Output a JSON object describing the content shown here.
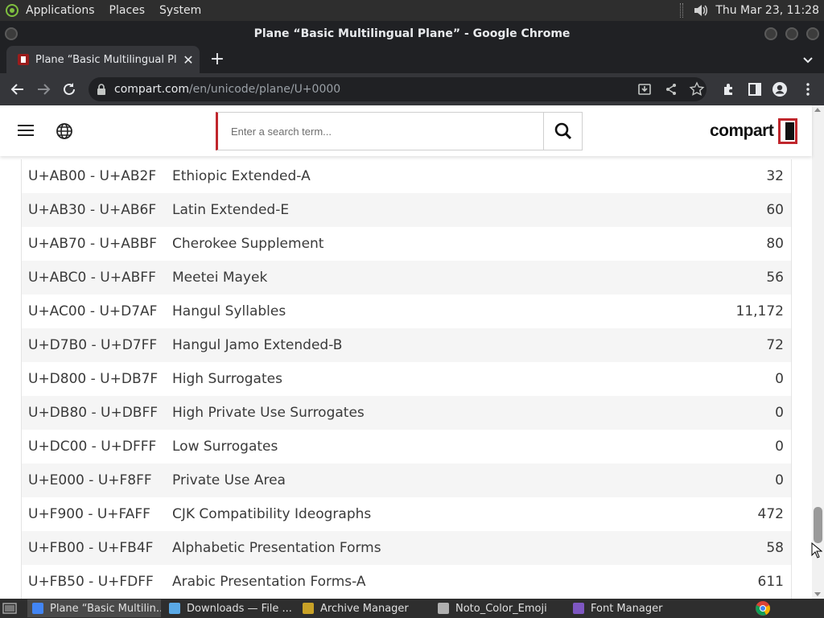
{
  "desktop": {
    "menus": [
      "Applications",
      "Places",
      "System"
    ],
    "clock": "Thu Mar 23, 11:28"
  },
  "window": {
    "title": "Plane “Basic Multilingual Plane” - Google Chrome"
  },
  "tab": {
    "title": "Plane “Basic Multilingual Plan",
    "close": "✕",
    "new": "+"
  },
  "omnibox": {
    "host": "compart.com",
    "path": "/en/unicode/plane/U+0000"
  },
  "site": {
    "search_placeholder": "Enter a search term...",
    "logo_text": "compart"
  },
  "blocks": [
    {
      "range": "U+AB00 - U+AB2F",
      "name": "Ethiopic Extended-A",
      "count": "32"
    },
    {
      "range": "U+AB30 - U+AB6F",
      "name": "Latin Extended-E",
      "count": "60"
    },
    {
      "range": "U+AB70 - U+ABBF",
      "name": "Cherokee Supplement",
      "count": "80"
    },
    {
      "range": "U+ABC0 - U+ABFF",
      "name": "Meetei Mayek",
      "count": "56"
    },
    {
      "range": "U+AC00 - U+D7AF",
      "name": "Hangul Syllables",
      "count": "11,172"
    },
    {
      "range": "U+D7B0 - U+D7FF",
      "name": "Hangul Jamo Extended-B",
      "count": "72"
    },
    {
      "range": "U+D800 - U+DB7F",
      "name": "High Surrogates",
      "count": "0"
    },
    {
      "range": "U+DB80 - U+DBFF",
      "name": "High Private Use Surrogates",
      "count": "0"
    },
    {
      "range": "U+DC00 - U+DFFF",
      "name": "Low Surrogates",
      "count": "0"
    },
    {
      "range": "U+E000 - U+F8FF",
      "name": "Private Use Area",
      "count": "0"
    },
    {
      "range": "U+F900 - U+FAFF",
      "name": "CJK Compatibility Ideographs",
      "count": "472"
    },
    {
      "range": "U+FB00 - U+FB4F",
      "name": "Alphabetic Presentation Forms",
      "count": "58"
    },
    {
      "range": "U+FB50 - U+FDFF",
      "name": "Arabic Presentation Forms-A",
      "count": "611"
    }
  ],
  "taskbar": [
    {
      "label": "Plane “Basic Multilin...",
      "icon": "chrome-icon",
      "active": true
    },
    {
      "label": "Downloads — File ...",
      "icon": "file-manager-icon",
      "active": false
    },
    {
      "label": "Archive Manager",
      "icon": "archive-manager-icon",
      "active": false
    },
    {
      "label": "Noto_Color_Emoji",
      "icon": "folder-icon",
      "active": false
    },
    {
      "label": "Font Manager",
      "icon": "font-manager-icon",
      "active": false
    }
  ],
  "colors": {
    "accent": "#c0262c",
    "chrome_dark": "#202124",
    "chrome_toolbar": "#35363a",
    "row_alt": "#f5f5f5"
  }
}
